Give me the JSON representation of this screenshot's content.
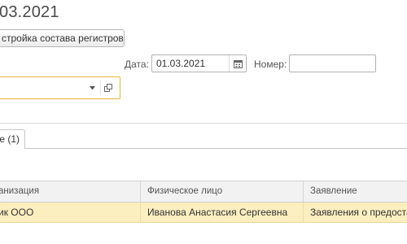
{
  "document": {
    "title": "03.2021"
  },
  "toolbar": {
    "registers_button_label": "стройка состава регистров"
  },
  "form": {
    "date_label": "Дата:",
    "date_value": "01.03.2021",
    "number_label": "Номер:",
    "number_value": "",
    "organization_value": ""
  },
  "tabs": [
    {
      "label": "е (1)"
    }
  ],
  "table": {
    "columns": [
      "анизация",
      "Физическое лицо",
      "Заявление"
    ],
    "rows": [
      [
        "ик ООО",
        "Иванова Анастасия Сергеевна",
        "Заявления о предоставле"
      ]
    ]
  },
  "icons": {
    "date_picker": "calendar-icon",
    "org_dropdown": "dropdown-arrow-icon",
    "org_open": "open-form-icon"
  },
  "colors": {
    "selected_row": "#fbeebf",
    "focus_border": "#e5b73b"
  }
}
